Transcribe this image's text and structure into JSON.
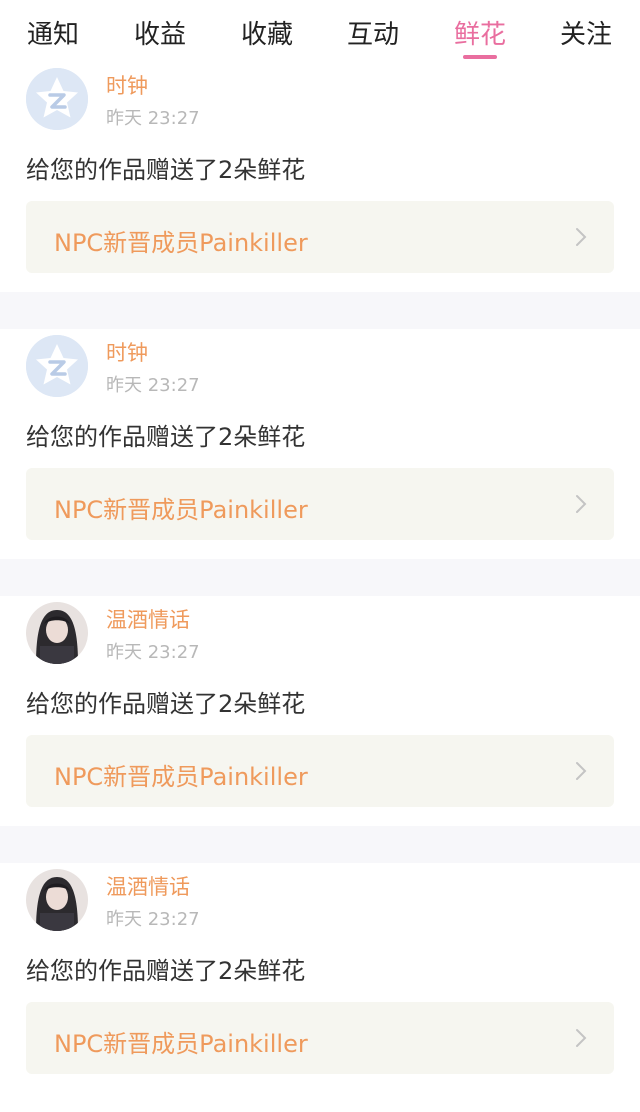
{
  "tabs": [
    {
      "label": "通知",
      "active": false
    },
    {
      "label": "收益",
      "active": false
    },
    {
      "label": "收藏",
      "active": false
    },
    {
      "label": "互动",
      "active": false
    },
    {
      "label": "鲜花",
      "active": true
    },
    {
      "label": "关注",
      "active": false
    }
  ],
  "colors": {
    "accent_pink": "#e96e9f",
    "username_orange": "#ef9a5c",
    "link_bg": "#f6f6f0",
    "separator": "#f7f7fa"
  },
  "notifications": [
    {
      "user": "时钟",
      "avatar": "default-star-avatar-icon",
      "time": "昨天 23:27",
      "message": "给您的作品赠送了2朵鲜花",
      "work_title": "NPC新晋成员Painkiller",
      "chevron": "chevron-right-icon"
    },
    {
      "user": "时钟",
      "avatar": "default-star-avatar-icon",
      "time": "昨天 23:27",
      "message": "给您的作品赠送了2朵鲜花",
      "work_title": "NPC新晋成员Painkiller",
      "chevron": "chevron-right-icon"
    },
    {
      "user": "温酒情话",
      "avatar": "photo-avatar",
      "time": "昨天 23:27",
      "message": "给您的作品赠送了2朵鲜花",
      "work_title": "NPC新晋成员Painkiller",
      "chevron": "chevron-right-icon"
    },
    {
      "user": "温酒情话",
      "avatar": "photo-avatar",
      "time": "昨天 23:27",
      "message": "给您的作品赠送了2朵鲜花",
      "work_title": "NPC新晋成员Painkiller",
      "chevron": "chevron-right-icon"
    }
  ]
}
